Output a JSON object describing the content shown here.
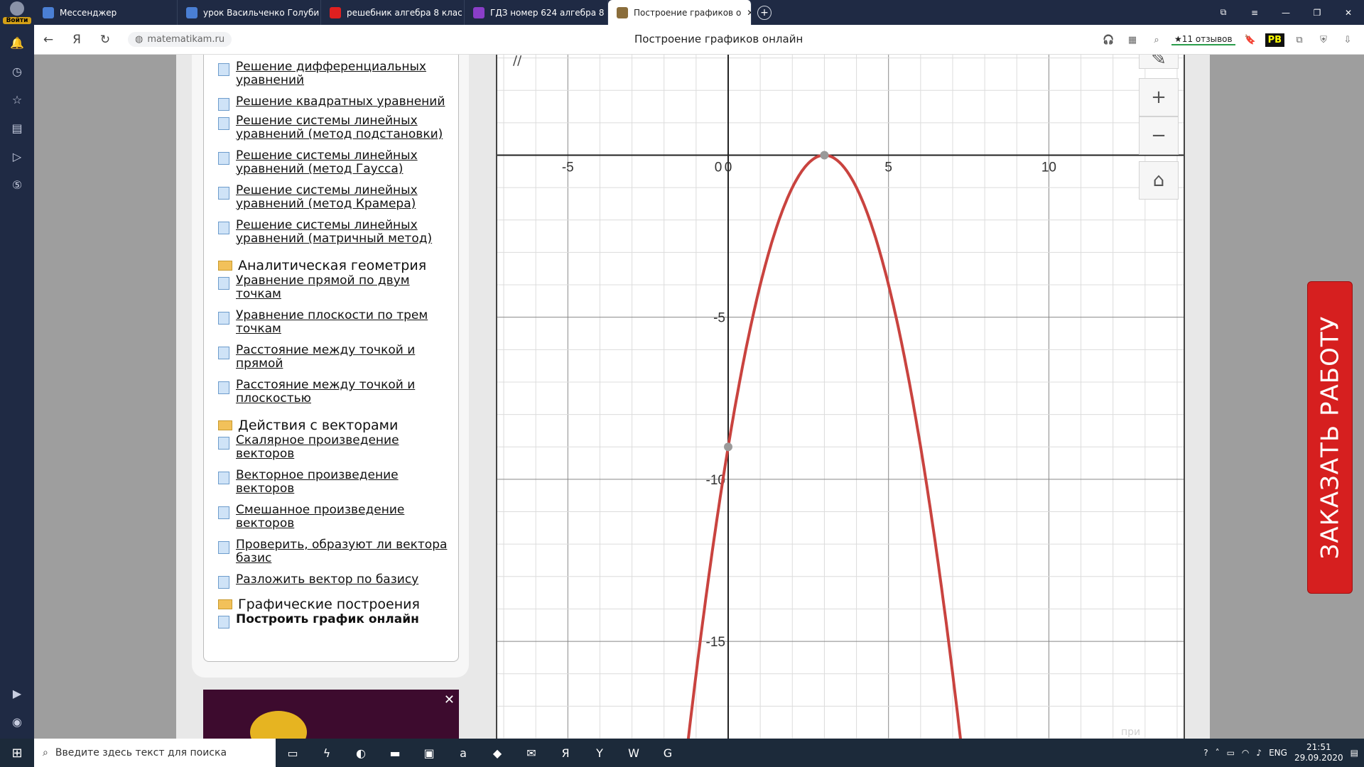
{
  "browser": {
    "login_label": "Войти",
    "tabs": [
      {
        "title": "Мессенджер",
        "color": "#4a7fd4"
      },
      {
        "title": "урок Васильченко Голуби",
        "color": "#4a7fd4"
      },
      {
        "title": "решебник алгебра 8 клас",
        "color": "#e02020"
      },
      {
        "title": "ГДЗ номер 624 алгебра 8",
        "color": "#8a3ec8"
      },
      {
        "title": "Построение графиков о",
        "color": "#8a6d3b"
      }
    ],
    "url": "matematikam.ru",
    "page_title": "Построение графиков онлайн",
    "reviews": "★11 отзывов",
    "rb": "PB"
  },
  "sidebar": {
    "items": [
      {
        "type": "item",
        "label": "Решение дифференциальных уравнений"
      },
      {
        "type": "item",
        "label": "Решение квадратных уравнений"
      },
      {
        "type": "item",
        "label": "Решение системы линейных уравнений (метод подстановки)"
      },
      {
        "type": "item",
        "label": "Решение системы линейных уравнений (метод Гаусса)"
      },
      {
        "type": "item",
        "label": "Решение системы линейных уравнений (метод Крамера)"
      },
      {
        "type": "item",
        "label": "Решение системы линейных уравнений (матричный метод)"
      },
      {
        "type": "cat",
        "label": "Аналитическая геометрия"
      },
      {
        "type": "item",
        "label": "Уравнение прямой по двум точкам"
      },
      {
        "type": "item",
        "label": "Уравнение плоскости по трем точкам"
      },
      {
        "type": "item",
        "label": "Расстояние между точкой и прямой"
      },
      {
        "type": "item",
        "label": "Расстояние между точкой и плоскостью"
      },
      {
        "type": "cat",
        "label": "Действия с векторами"
      },
      {
        "type": "item",
        "label": "Скалярное произведение векторов"
      },
      {
        "type": "item",
        "label": "Векторное произведение векторов"
      },
      {
        "type": "item",
        "label": "Смешанное произведение векторов"
      },
      {
        "type": "item",
        "label": "Проверить, образуют ли вектора базис"
      },
      {
        "type": "item",
        "label": "Разложить вектор по базису"
      },
      {
        "type": "cat",
        "label": "Графические построения"
      },
      {
        "type": "item",
        "label": "Построить график онлайн",
        "bold": true
      }
    ]
  },
  "graph": {
    "zoom_in": "+",
    "zoom_out": "−",
    "watermark": "при поддержке"
  },
  "chart_data": {
    "type": "line",
    "title": "",
    "xlabel": "",
    "ylabel": "",
    "xlim": [
      -7.2,
      14.2
    ],
    "ylim": [
      -18,
      3.1
    ],
    "x_ticks": [
      -5,
      0,
      5,
      10
    ],
    "y_ticks": [
      -5,
      -10,
      -15
    ],
    "grid": true,
    "series": [
      {
        "name": "",
        "color": "#c9433f",
        "function": "-(x-3)^2",
        "x": [
          -1.3,
          -1,
          0,
          1,
          2,
          3,
          4,
          5,
          6,
          7,
          7.3
        ],
        "y": [
          -18.49,
          -16,
          -9,
          -4,
          -1,
          0,
          -1,
          -4,
          -9,
          -16,
          -18.49
        ]
      }
    ],
    "points": [
      {
        "x": 3,
        "y": 0
      },
      {
        "x": 0,
        "y": -9
      }
    ]
  },
  "order_button": "ЗАКАЗАТЬ РАБОТУ",
  "taskbar": {
    "search_placeholder": "Введите здесь текст для поиска",
    "lang": "ENG",
    "time": "21:51",
    "date": "29.09.2020"
  }
}
